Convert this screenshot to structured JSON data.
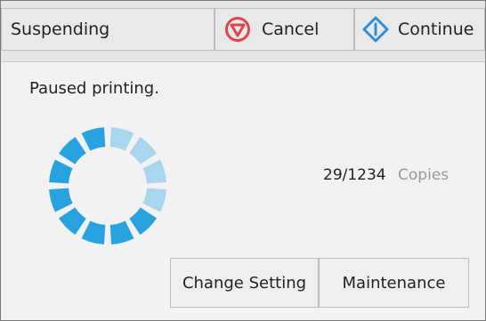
{
  "header": {
    "status_label": "Suspending",
    "cancel_label": "Cancel",
    "continue_label": "Continue"
  },
  "message": "Paused printing.",
  "copies": {
    "count": "29/1234",
    "unit_label": "Copies"
  },
  "buttons": {
    "change_setting_label": "Change Setting",
    "maintenance_label": "Maintenance"
  },
  "spinner": {
    "segments": 12,
    "active_segments": 8,
    "active_color": "#29a3e0",
    "inactive_color": "#a8d6ee"
  },
  "colors": {
    "cancel_icon": "#e0454a",
    "continue_icon": "#2f8fd6"
  }
}
